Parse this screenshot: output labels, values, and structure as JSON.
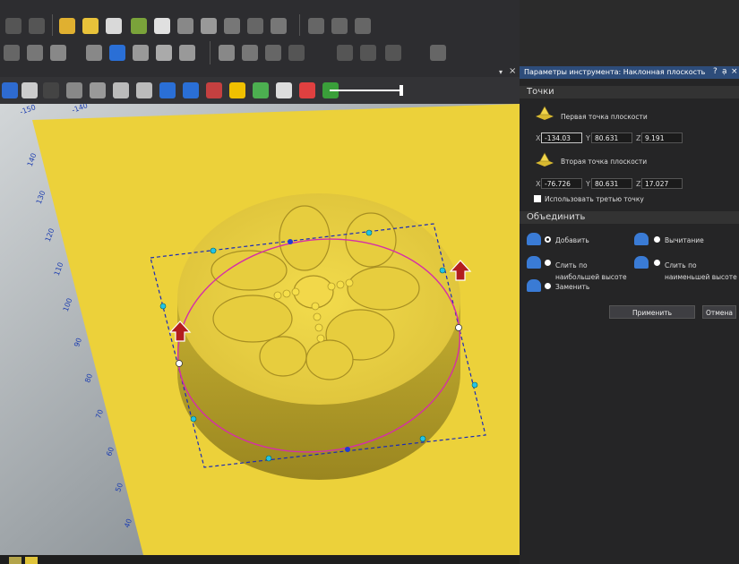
{
  "panel": {
    "title": "Параметры инструмента: Наклонная плоскость",
    "controls": {
      "help": "?",
      "pin": "ạ",
      "close": "×"
    },
    "points_header": "Точки",
    "first_point": {
      "label": "Первая точка плоскости",
      "x": "-134.03",
      "y": "80.631",
      "z": "9.191"
    },
    "second_point": {
      "label": "Вторая точка плоскости",
      "x": "-76.726",
      "y": "80.631",
      "z": "17.027"
    },
    "axis_labels": {
      "x": "X",
      "y": "Y",
      "z": "Z"
    },
    "third_point_label": "Использовать третью точку",
    "combine_header": "Объединить",
    "combine_options": {
      "add": "Добавить",
      "subtract": "Вычитание",
      "merge_high": "Слить по наибольшей высоте",
      "merge_low": "Слить по наименьшей высоте",
      "replace": "Заменить"
    },
    "apply_label": "Применить",
    "cancel_label": "Отмена"
  },
  "ruler": {
    "top_labels": [
      "-150",
      "-140"
    ],
    "left_labels": [
      "140",
      "130",
      "120",
      "110",
      "100",
      "90",
      "80",
      "70",
      "60",
      "50",
      "40"
    ]
  },
  "colors": {
    "plane": "#ecd13a",
    "relief": "#d8c23e",
    "selection_ellipse": "#d62ea7",
    "bounding_box": "#1a2ab8",
    "panel_title_bar": "#2d4c7a",
    "arrow": "#b31e1e"
  },
  "icons": {
    "first_point_icon": "plane-point-icon",
    "second_point_icon": "plane-point-icon"
  }
}
